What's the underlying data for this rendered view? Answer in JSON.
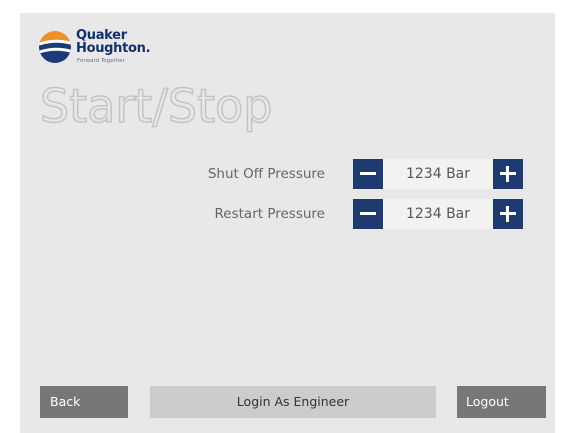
{
  "brand": {
    "name_line1": "Quaker",
    "name_line2": "Houghton.",
    "tagline": "Forward Together"
  },
  "page": {
    "title": "Start/Stop"
  },
  "settings": [
    {
      "label": "Shut Off Pressure",
      "value": "1234 Bar"
    },
    {
      "label": "Restart Pressure",
      "value": "1234 Bar"
    }
  ],
  "footer": {
    "back": "Back",
    "login_engineer": "Login As Engineer",
    "logout": "Logout"
  },
  "colors": {
    "stepper_button": "#1e3a6e",
    "panel_background": "#e8e8e8",
    "footer_button_dark": "#777777",
    "footer_button_light": "#cccccc"
  },
  "icons": {
    "decrement": "minus-icon",
    "increment": "plus-icon"
  }
}
